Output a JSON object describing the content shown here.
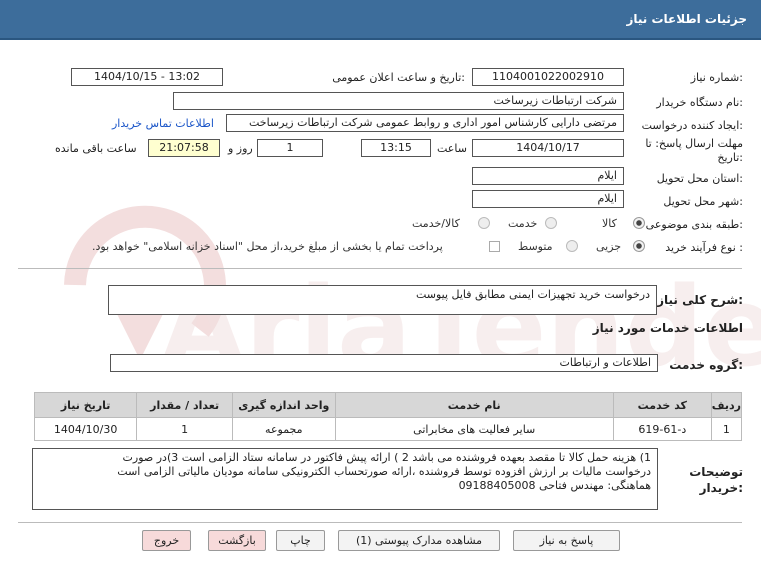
{
  "header": {
    "title": "جزئیات اطلاعات نیاز"
  },
  "fields": {
    "need_number_label": "شماره نیاز:",
    "need_number": "1104001022002910",
    "announce_label": "تاریخ و ساعت اعلان عمومی:",
    "announce_value": "1404/10/15 - 13:02",
    "buyer_label": "نام دستگاه خریدار:",
    "buyer_value": "شرکت ارتباطات زیرساخت",
    "creator_label": "ایجاد کننده درخواست:",
    "creator_value": "مرتضی دارایی کارشناس امور اداری و روابط عمومی شرکت ارتباطات زیرساخت",
    "contact_link": "اطلاعات تماس خریدار",
    "deadline_label_1": "مهلت ارسال پاسخ: تا",
    "deadline_label_2": "تاریخ:",
    "deadline_date": "1404/10/17",
    "time_label": "ساعت",
    "deadline_time": "13:15",
    "days_value": "1",
    "days_label": "روز و",
    "remaining_time": "21:07:58",
    "remaining_label": "ساعت باقی مانده",
    "province_label": "استان محل تحویل:",
    "province_value": "ایلام",
    "city_label": "شهر محل تحویل:",
    "city_value": "ایلام",
    "category_label": "طبقه بندی موضوعی:",
    "category_options": [
      "کالا",
      "خدمت",
      "کالا/خدمت"
    ],
    "process_label": "نوع فرآیند خرید :",
    "process_options": [
      "جزیی",
      "متوسط"
    ],
    "payment_note": "پرداخت تمام یا بخشی از مبلغ خرید،از محل \"اسناد خزانه اسلامی\" خواهد بود."
  },
  "summary": {
    "label": "شرح کلی نیاز:",
    "value": "درخواست خرید تجهیزات ایمنی مطابق فایل پیوست"
  },
  "services_info_title": "اطلاعات خدمات مورد نیاز",
  "service_group": {
    "label": "گروه خدمت:",
    "value": "اطلاعات و ارتباطات"
  },
  "table": {
    "headers": [
      "ردیف",
      "کد خدمت",
      "نام خدمت",
      "واحد اندازه گیری",
      "تعداد / مقدار",
      "تاریخ نیاز"
    ],
    "rows": [
      [
        "1",
        "د-61-619",
        "سایر فعالیت های مخابراتی",
        "مجموعه",
        "1",
        "1404/10/30"
      ]
    ]
  },
  "buyer_notes": {
    "label_1": "توضیحات",
    "label_2": "خریدار:",
    "line_1": "1)  هزینه  حمل کالا تا مقصد بعهده فروشنده می باشد 2 ) ارائه پیش فاکتور در سامانه ستاد  الزامی است 3)در صورت",
    "line_2": "درخواست مالیات بر ارزش افزوده  توسط فروشنده ،ارائه صورتحساب الکترونیکی سامانه مودیان مالیاتی الزامی است",
    "line_3": "هماهنگی:    مهندس فتاحی 09188405008"
  },
  "buttons": {
    "reply": "پاسخ به نیاز",
    "view_docs": "مشاهده مدارک پیوستی (1)",
    "print": "چاپ",
    "back": "بازگشت",
    "exit": "خروج"
  },
  "watermark": {
    "text": "AriaTender.net"
  },
  "colors": {
    "header": "#3d6d9b",
    "link": "#1a55c8",
    "time_highlight": "#ffffd0",
    "watermark": "#f2dcdc"
  }
}
